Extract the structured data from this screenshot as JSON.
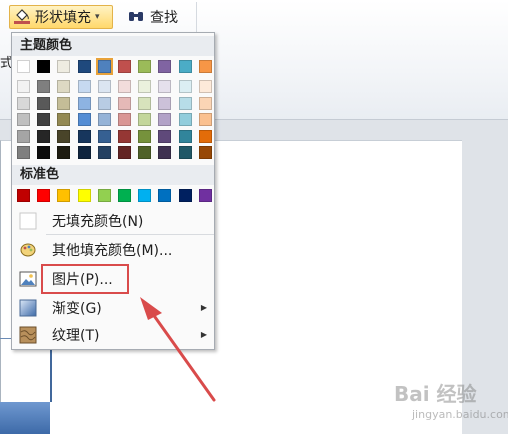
{
  "ribbon": {
    "fill_button_label": "形状填充",
    "find_button_label": "查找",
    "side_fragment": "式"
  },
  "menu": {
    "theme_colors_heading": "主题颜色",
    "standard_colors_heading": "标准色",
    "theme_top_row": [
      "#ffffff",
      "#000000",
      "#eeece1",
      "#1f497d",
      "#4f81bd",
      "#c0504d",
      "#9bbb59",
      "#8064a2",
      "#4bacc6",
      "#f79646"
    ],
    "theme_shade_columns": [
      [
        "#f2f2f2",
        "#d8d8d8",
        "#bfbfbf",
        "#a5a5a5",
        "#7f7f7f"
      ],
      [
        "#7f7f7f",
        "#595959",
        "#3f3f3f",
        "#262626",
        "#0c0c0c"
      ],
      [
        "#ddd9c3",
        "#c4bd97",
        "#938953",
        "#494429",
        "#1d1b10"
      ],
      [
        "#c6d9f0",
        "#8db3e2",
        "#548dd4",
        "#17365d",
        "#0f243e"
      ],
      [
        "#dbe5f1",
        "#b8cce4",
        "#95b3d7",
        "#366092",
        "#244061"
      ],
      [
        "#f2dcdb",
        "#e5b9b7",
        "#d99694",
        "#953734",
        "#632423"
      ],
      [
        "#ebf1dd",
        "#d7e3bc",
        "#c3d69b",
        "#76923c",
        "#4f6128"
      ],
      [
        "#e5e0ec",
        "#ccc1d9",
        "#b2a2c7",
        "#5f497a",
        "#3f3151"
      ],
      [
        "#dbeef3",
        "#b7dde8",
        "#92cddc",
        "#31859b",
        "#205867"
      ],
      [
        "#fdeada",
        "#fbd5b5",
        "#fac08f",
        "#e36c09",
        "#974806"
      ]
    ],
    "standard_colors": [
      "#c00000",
      "#ff0000",
      "#ffc000",
      "#ffff00",
      "#92d050",
      "#00b050",
      "#00b0f0",
      "#0070c0",
      "#002060",
      "#7030a0"
    ],
    "no_fill_label": "无填充颜色(N)",
    "more_colors_label": "其他填充颜色(M)...",
    "picture_label": "图片(P)...",
    "gradient_label": "渐变(G)",
    "texture_label": "纹理(T)"
  },
  "watermark": {
    "brand": "Bai 经验",
    "url": "jingyan.baidu.com"
  },
  "colors": {
    "highlight": "#d94b4b",
    "ribbon_active": "#ffd86b"
  }
}
